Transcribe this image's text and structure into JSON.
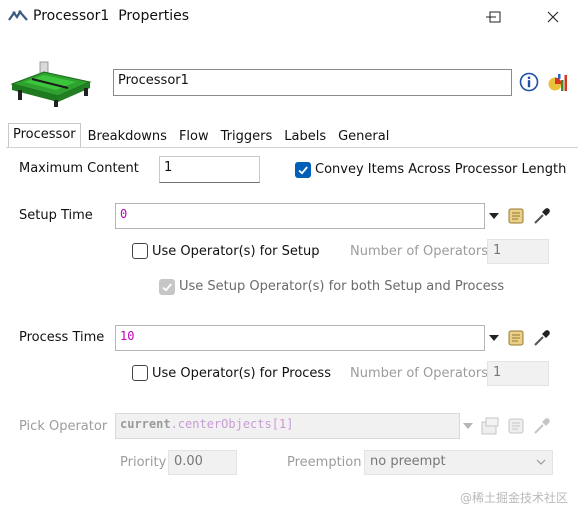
{
  "window": {
    "title": "Processor1  Properties",
    "buttons": [
      "minimize",
      "maximize",
      "close"
    ]
  },
  "header": {
    "object_name": "Processor1",
    "icons": [
      "processor-model-icon",
      "info-icon",
      "statistics-icon"
    ]
  },
  "tabs": [
    {
      "label": "Processor",
      "active": true
    },
    {
      "label": "Breakdowns",
      "active": false
    },
    {
      "label": "Flow",
      "active": false
    },
    {
      "label": "Triggers",
      "active": false
    },
    {
      "label": "Labels",
      "active": false
    },
    {
      "label": "General",
      "active": false
    }
  ],
  "processor": {
    "max_content": {
      "label": "Maximum Content",
      "value": "1"
    },
    "convey": {
      "label": "Convey Items Across Processor Length",
      "checked": true
    },
    "setup_time": {
      "label": "Setup Time",
      "value": "0"
    },
    "setup_use_operators": {
      "label": "Use Operator(s) for Setup",
      "checked": false
    },
    "setup_num_operators": {
      "label": "Number of Operators",
      "value": "1",
      "enabled": false
    },
    "use_setup_both": {
      "label": "Use Setup Operator(s) for both Setup and Process",
      "checked": true,
      "enabled": false
    },
    "process_time": {
      "label": "Process Time",
      "value": "10"
    },
    "process_use_operators": {
      "label": "Use Operator(s) for Process",
      "checked": false
    },
    "process_num_operators": {
      "label": "Number of Operators",
      "value": "1",
      "enabled": false
    },
    "pick_operator": {
      "label": "Pick Operator",
      "value_keyword": "current",
      "value_rest": ".centerObjects[",
      "value_index": "1",
      "value_close": "]",
      "enabled": false
    },
    "priority": {
      "label": "Priority",
      "value": "0.00"
    },
    "preemption": {
      "label": "Preemption",
      "value": "no preempt"
    }
  },
  "watermark": "@稀土掘金技术社区",
  "colors": {
    "accent": "#005fb8",
    "code_text": "#c000c0",
    "disabled_text": "#9c9c9c"
  }
}
